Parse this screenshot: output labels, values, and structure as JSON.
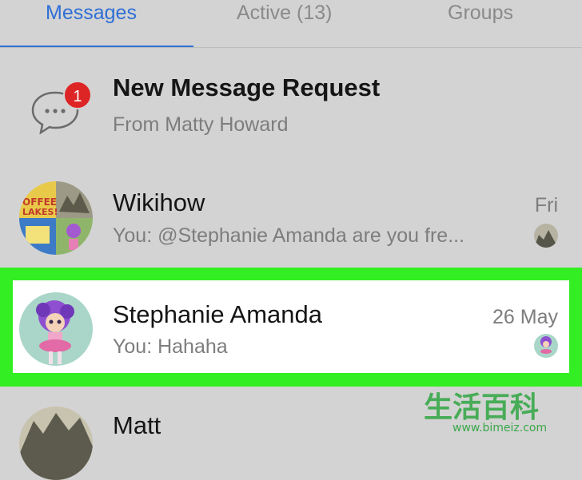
{
  "tabs": [
    {
      "label": "Messages",
      "active": true
    },
    {
      "label": "Active (13)",
      "active": false
    },
    {
      "label": "Groups",
      "active": false
    }
  ],
  "request": {
    "title": "New Message Request",
    "subtitle": "From Matty Howard",
    "badge": "1",
    "icon": "chat-bubble-ellipsis-icon"
  },
  "conversations": [
    {
      "name": "Wikihow",
      "preview": "You: @Stephanie Amanda are you fre...",
      "time": "Fri",
      "highlighted": false
    },
    {
      "name": "Stephanie Amanda",
      "preview": "You: Hahaha",
      "time": "26 May",
      "highlighted": true
    },
    {
      "name": "Matt",
      "preview": "",
      "time": "",
      "highlighted": false
    }
  ],
  "watermark": {
    "chars": "生活百科",
    "url": "www.bimeiz.com"
  },
  "colors": {
    "accent": "#2f6fd6",
    "badge": "#dd2525",
    "highlight": "#33ee22",
    "background": "#d3d3d3"
  }
}
